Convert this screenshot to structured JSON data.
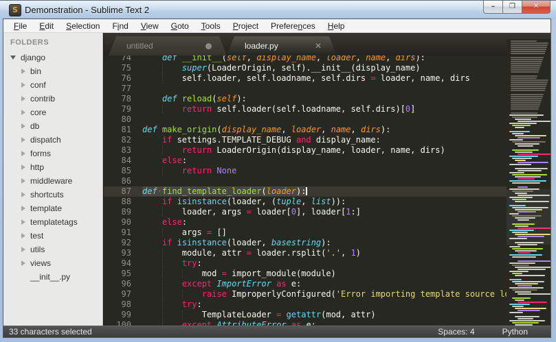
{
  "window": {
    "title": "Demonstration - Sublime Text 2",
    "icon_letter": "S",
    "controls": {
      "minimize": "–",
      "maximize": "❐",
      "close": "✕"
    }
  },
  "menu": {
    "items": [
      {
        "label": "File",
        "u": 0
      },
      {
        "label": "Edit",
        "u": 0
      },
      {
        "label": "Selection",
        "u": 0
      },
      {
        "label": "Find",
        "u": 1
      },
      {
        "label": "View",
        "u": 0
      },
      {
        "label": "Goto",
        "u": 0
      },
      {
        "label": "Tools",
        "u": 0
      },
      {
        "label": "Project",
        "u": 0
      },
      {
        "label": "Preferences",
        "u": 7
      },
      {
        "label": "Help",
        "u": 0
      }
    ]
  },
  "sidebar": {
    "header": "FOLDERS",
    "tree": [
      {
        "label": "django",
        "state": "expanded",
        "depth": 0
      },
      {
        "label": "bin",
        "state": "collapsed",
        "depth": 1
      },
      {
        "label": "conf",
        "state": "collapsed",
        "depth": 1
      },
      {
        "label": "contrib",
        "state": "collapsed",
        "depth": 1
      },
      {
        "label": "core",
        "state": "collapsed",
        "depth": 1
      },
      {
        "label": "db",
        "state": "collapsed",
        "depth": 1
      },
      {
        "label": "dispatch",
        "state": "collapsed",
        "depth": 1
      },
      {
        "label": "forms",
        "state": "collapsed",
        "depth": 1
      },
      {
        "label": "http",
        "state": "collapsed",
        "depth": 1
      },
      {
        "label": "middleware",
        "state": "collapsed",
        "depth": 1
      },
      {
        "label": "shortcuts",
        "state": "collapsed",
        "depth": 1
      },
      {
        "label": "template",
        "state": "collapsed",
        "depth": 1
      },
      {
        "label": "templatetags",
        "state": "collapsed",
        "depth": 1
      },
      {
        "label": "test",
        "state": "collapsed",
        "depth": 1
      },
      {
        "label": "utils",
        "state": "collapsed",
        "depth": 1
      },
      {
        "label": "views",
        "state": "collapsed",
        "depth": 1
      },
      {
        "label": "__init__.py",
        "state": "file",
        "depth": 1
      }
    ]
  },
  "tabs": [
    {
      "label": "untitled",
      "state": "inactive",
      "indicator": "dot"
    },
    {
      "label": "loader.py",
      "state": "active",
      "indicator": "close",
      "close_glyph": "✕"
    }
  ],
  "editor": {
    "syntax_colors": {
      "background": "#272822",
      "foreground": "#F8F8F2",
      "keyword_pink": "#F92672",
      "type_cyan": "#66D9EF",
      "function_green": "#A6E22E",
      "param_orange": "#FD971F",
      "string_yellow": "#E6DB74",
      "number_purple": "#AE81FF",
      "selection": "#49483E",
      "line_numbers": "#8F908A"
    },
    "lines": [
      {
        "n": 74,
        "tokens": [
          [
            "w",
            "    "
          ],
          [
            "bi",
            "def"
          ],
          [
            "w",
            " "
          ],
          [
            "f",
            "__init__"
          ],
          [
            "w",
            "("
          ],
          [
            "p",
            "self"
          ],
          [
            "w",
            ", "
          ],
          [
            "p",
            "display_name"
          ],
          [
            "w",
            ", "
          ],
          [
            "p",
            "loader"
          ],
          [
            "w",
            ", "
          ],
          [
            "p",
            "name"
          ],
          [
            "w",
            ", "
          ],
          [
            "p",
            "dirs"
          ],
          [
            "w",
            "):"
          ]
        ]
      },
      {
        "n": 75,
        "tokens": [
          [
            "w",
            "        "
          ],
          [
            "bi",
            "super"
          ],
          [
            "w",
            "(LoaderOrigin, self).__init__(display_name)"
          ]
        ]
      },
      {
        "n": 76,
        "tokens": [
          [
            "w",
            "        self.loader, self.loadname, self.dirs "
          ],
          [
            "k",
            "="
          ],
          [
            "w",
            " loader, name, dirs"
          ]
        ]
      },
      {
        "n": 77,
        "tokens": []
      },
      {
        "n": 78,
        "tokens": [
          [
            "w",
            "    "
          ],
          [
            "bi",
            "def"
          ],
          [
            "w",
            " "
          ],
          [
            "f",
            "reload"
          ],
          [
            "w",
            "("
          ],
          [
            "p",
            "self"
          ],
          [
            "w",
            "):"
          ]
        ]
      },
      {
        "n": 79,
        "tokens": [
          [
            "w",
            "        "
          ],
          [
            "k",
            "return"
          ],
          [
            "w",
            " self.loader(self.loadname, self.dirs)["
          ],
          [
            "n",
            "0"
          ],
          [
            "w",
            "]"
          ]
        ]
      },
      {
        "n": 80,
        "tokens": []
      },
      {
        "n": 81,
        "tokens": [
          [
            "bi",
            "def"
          ],
          [
            "w",
            " "
          ],
          [
            "f",
            "make_origin"
          ],
          [
            "w",
            "("
          ],
          [
            "p",
            "display_name"
          ],
          [
            "w",
            ", "
          ],
          [
            "p",
            "loader"
          ],
          [
            "w",
            ", "
          ],
          [
            "p",
            "name"
          ],
          [
            "w",
            ", "
          ],
          [
            "p",
            "dirs"
          ],
          [
            "w",
            "):"
          ]
        ]
      },
      {
        "n": 82,
        "tokens": [
          [
            "w",
            "    "
          ],
          [
            "k",
            "if"
          ],
          [
            "w",
            " settings.TEMPLATE_DEBUG "
          ],
          [
            "k",
            "and"
          ],
          [
            "w",
            " display_name:"
          ]
        ]
      },
      {
        "n": 83,
        "tokens": [
          [
            "w",
            "        "
          ],
          [
            "k",
            "return"
          ],
          [
            "w",
            " LoaderOrigin(display_name, loader, name, dirs)"
          ]
        ]
      },
      {
        "n": 84,
        "tokens": [
          [
            "w",
            "    "
          ],
          [
            "k",
            "else"
          ],
          [
            "w",
            ":"
          ]
        ]
      },
      {
        "n": 85,
        "tokens": [
          [
            "w",
            "        "
          ],
          [
            "k",
            "return"
          ],
          [
            "w",
            " "
          ],
          [
            "n",
            "None"
          ]
        ]
      },
      {
        "n": 86,
        "tokens": []
      },
      {
        "n": 87,
        "selected": true,
        "cursor": true,
        "tokens": [
          [
            "bi",
            "def"
          ],
          [
            "ws",
            "·"
          ],
          [
            "f",
            "find_template_loader"
          ],
          [
            "w",
            "("
          ],
          [
            "p",
            "loader"
          ],
          [
            "w",
            "):"
          ]
        ]
      },
      {
        "n": 88,
        "tokens": [
          [
            "w",
            "    "
          ],
          [
            "k",
            "if"
          ],
          [
            "w",
            " "
          ],
          [
            "b",
            "isinstance"
          ],
          [
            "w",
            "(loader, ("
          ],
          [
            "bi",
            "tuple"
          ],
          [
            "w",
            ", "
          ],
          [
            "bi",
            "list"
          ],
          [
            "w",
            ")):"
          ]
        ]
      },
      {
        "n": 89,
        "tokens": [
          [
            "w",
            "        loader, args "
          ],
          [
            "k",
            "="
          ],
          [
            "w",
            " loader["
          ],
          [
            "n",
            "0"
          ],
          [
            "w",
            "], loader["
          ],
          [
            "n",
            "1"
          ],
          [
            "w",
            ":]"
          ]
        ]
      },
      {
        "n": 90,
        "tokens": [
          [
            "w",
            "    "
          ],
          [
            "k",
            "else"
          ],
          [
            "w",
            ":"
          ]
        ]
      },
      {
        "n": 91,
        "tokens": [
          [
            "w",
            "        args "
          ],
          [
            "k",
            "="
          ],
          [
            "w",
            " []"
          ]
        ]
      },
      {
        "n": 92,
        "tokens": [
          [
            "w",
            "    "
          ],
          [
            "k",
            "if"
          ],
          [
            "w",
            " "
          ],
          [
            "b",
            "isinstance"
          ],
          [
            "w",
            "(loader, "
          ],
          [
            "bi",
            "basestring"
          ],
          [
            "w",
            "):"
          ]
        ]
      },
      {
        "n": 93,
        "tokens": [
          [
            "w",
            "        module, attr "
          ],
          [
            "k",
            "="
          ],
          [
            "w",
            " loader.rsplit("
          ],
          [
            "s",
            "'.'"
          ],
          [
            "w",
            ", "
          ],
          [
            "n",
            "1"
          ],
          [
            "w",
            ")"
          ]
        ]
      },
      {
        "n": 94,
        "tokens": [
          [
            "w",
            "        "
          ],
          [
            "k",
            "try"
          ],
          [
            "w",
            ":"
          ]
        ]
      },
      {
        "n": 95,
        "tokens": [
          [
            "w",
            "            mod "
          ],
          [
            "k",
            "="
          ],
          [
            "w",
            " import_module(module)"
          ]
        ]
      },
      {
        "n": 96,
        "tokens": [
          [
            "w",
            "        "
          ],
          [
            "k",
            "except"
          ],
          [
            "w",
            " "
          ],
          [
            "bi",
            "ImportError"
          ],
          [
            "w",
            " "
          ],
          [
            "k",
            "as"
          ],
          [
            "w",
            " e:"
          ]
        ]
      },
      {
        "n": 97,
        "tokens": [
          [
            "w",
            "            "
          ],
          [
            "k",
            "raise"
          ],
          [
            "w",
            " ImproperlyConfigured("
          ],
          [
            "s",
            "'Error importing template source loader %s'"
          ],
          [
            "w",
            ")"
          ]
        ]
      },
      {
        "n": 98,
        "tokens": [
          [
            "w",
            "        "
          ],
          [
            "k",
            "try"
          ],
          [
            "w",
            ":"
          ]
        ]
      },
      {
        "n": 99,
        "tokens": [
          [
            "w",
            "            TemplateLoader "
          ],
          [
            "k",
            "="
          ],
          [
            "w",
            " "
          ],
          [
            "b",
            "getattr"
          ],
          [
            "w",
            "(mod, attr)"
          ]
        ]
      },
      {
        "n": 100,
        "tokens": [
          [
            "w",
            "        "
          ],
          [
            "k",
            "except"
          ],
          [
            "w",
            " "
          ],
          [
            "bi",
            "AttributeError"
          ],
          [
            "w",
            " "
          ],
          [
            "k",
            "as"
          ],
          [
            "w",
            " e:"
          ]
        ]
      }
    ]
  },
  "minimap": {
    "docstring_rows": 36,
    "code_rows": 103,
    "viewport_top_row": 73,
    "viewport_rows": 27
  },
  "status": {
    "left": "33 characters selected",
    "spaces": "Spaces: 4",
    "syntax": "Python"
  }
}
